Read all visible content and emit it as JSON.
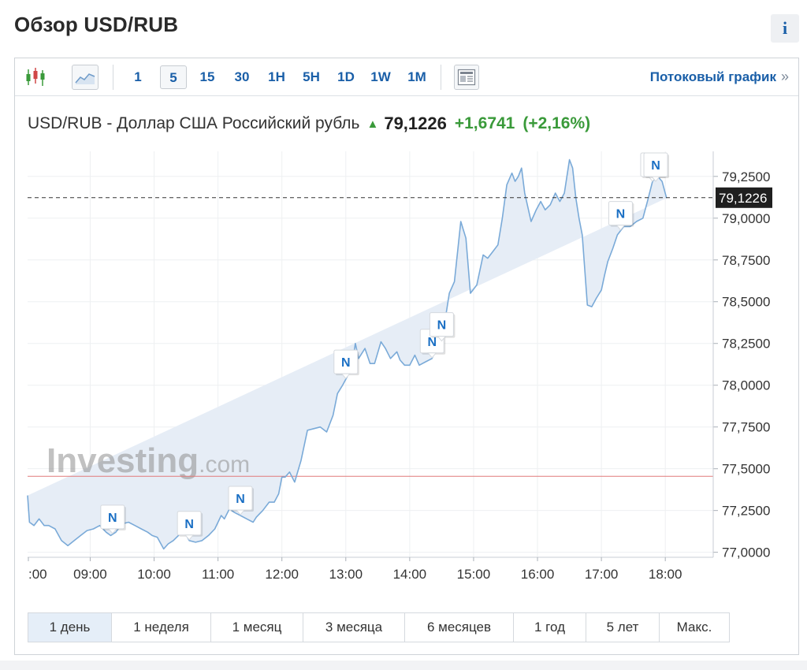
{
  "page": {
    "title": "Обзор USD/RUB",
    "info_label": "i"
  },
  "toolbar": {
    "intervals": [
      "1",
      "5",
      "15",
      "30",
      "1H",
      "5H",
      "1D",
      "1W",
      "1M"
    ],
    "active_interval": "5",
    "stream_link": "Потоковый график",
    "stream_arrow": "»",
    "icons": [
      "candlestick-icon",
      "area-chart-icon",
      "news-icon"
    ]
  },
  "quote": {
    "name": "USD/RUB - Доллар США Российский рубль",
    "price": "79,1226",
    "change": "+1,6741",
    "change_pct": "(+2,16%)",
    "direction_color": "#3a9a3a"
  },
  "watermark": {
    "brand": "Investing",
    "suffix": ".com"
  },
  "chart_data": {
    "type": "area",
    "x_unit": "hours",
    "xlim": [
      8.02,
      18.75
    ],
    "ylim": [
      76.97,
      79.4
    ],
    "y_ticks": [
      77.0,
      77.25,
      77.5,
      77.75,
      78.0,
      78.25,
      78.5,
      78.75,
      79.0,
      79.25
    ],
    "y_tick_labels": [
      "77,0000",
      "77,2500",
      "77,5000",
      "77,7500",
      "78,0000",
      "78,2500",
      "78,5000",
      "78,7500",
      "79,0000",
      "79,2500"
    ],
    "x_ticks": [
      8,
      9,
      10,
      11,
      12,
      13,
      14,
      15,
      16,
      17,
      18
    ],
    "x_tick_labels": [
      ":00",
      "09:00",
      "10:00",
      "11:00",
      "12:00",
      "13:00",
      "14:00",
      "15:00",
      "16:00",
      "17:00",
      "18:00"
    ],
    "current_price": 79.1226,
    "current_price_label": "79,1226",
    "previous_close": 77.455,
    "grid": true,
    "colors": {
      "line": "#7aaad8",
      "fill": "#e6edf6",
      "current": "#333333",
      "prev_close": "#e07a7a",
      "label_bg": "#1f1f1f"
    },
    "x": [
      8.02,
      8.05,
      8.12,
      8.2,
      8.28,
      8.35,
      8.45,
      8.55,
      8.65,
      8.75,
      8.85,
      8.95,
      9.05,
      9.15,
      9.25,
      9.32,
      9.4,
      9.5,
      9.6,
      9.7,
      9.8,
      9.9,
      9.97,
      10.05,
      10.15,
      10.22,
      10.3,
      10.38,
      10.45,
      10.55,
      10.65,
      10.75,
      10.85,
      10.95,
      11.05,
      11.1,
      11.18,
      11.25,
      11.35,
      11.45,
      11.55,
      11.6,
      11.7,
      11.8,
      11.88,
      11.95,
      12.0,
      12.05,
      12.12,
      12.2,
      12.3,
      12.4,
      12.5,
      12.6,
      12.7,
      12.8,
      12.87,
      12.95,
      13.02,
      13.1,
      13.15,
      13.2,
      13.3,
      13.38,
      13.45,
      13.55,
      13.62,
      13.7,
      13.8,
      13.85,
      13.92,
      14.0,
      14.08,
      14.15,
      14.25,
      14.35,
      14.45,
      14.5,
      14.55,
      14.62,
      14.7,
      14.8,
      14.88,
      14.95,
      15.05,
      15.15,
      15.22,
      15.3,
      15.38,
      15.45,
      15.52,
      15.6,
      15.65,
      15.7,
      15.75,
      15.8,
      15.9,
      15.98,
      16.05,
      16.12,
      16.2,
      16.28,
      16.35,
      16.42,
      16.5,
      16.55,
      16.6,
      16.65,
      16.7,
      16.78,
      16.85,
      16.92,
      17.0,
      17.05,
      17.1,
      17.18,
      17.25,
      17.35,
      17.45,
      17.55,
      17.65,
      17.72,
      17.8,
      17.88,
      17.95,
      18.02,
      18.1,
      18.18,
      18.25,
      18.35,
      18.45,
      18.55,
      18.65,
      18.72
    ],
    "y": [
      77.34,
      77.18,
      77.16,
      77.2,
      77.16,
      77.16,
      77.14,
      77.07,
      77.04,
      77.07,
      77.1,
      77.13,
      77.14,
      77.16,
      77.12,
      77.1,
      77.12,
      77.17,
      77.18,
      77.16,
      77.14,
      77.12,
      77.1,
      77.09,
      77.02,
      77.05,
      77.07,
      77.1,
      77.14,
      77.07,
      77.06,
      77.07,
      77.1,
      77.14,
      77.22,
      77.2,
      77.26,
      77.24,
      77.22,
      77.2,
      77.18,
      77.21,
      77.25,
      77.3,
      77.3,
      77.35,
      77.45,
      77.45,
      77.48,
      77.42,
      77.55,
      77.73,
      77.74,
      77.75,
      77.72,
      77.82,
      77.95,
      78.0,
      78.05,
      78.12,
      78.25,
      78.16,
      78.22,
      78.13,
      78.13,
      78.26,
      78.22,
      78.16,
      78.2,
      78.15,
      78.12,
      78.12,
      78.18,
      78.12,
      78.14,
      78.16,
      78.26,
      78.26,
      78.38,
      78.55,
      78.62,
      78.98,
      78.88,
      78.55,
      78.6,
      78.78,
      78.76,
      78.8,
      78.84,
      79.0,
      79.2,
      79.27,
      79.22,
      79.25,
      79.3,
      79.15,
      78.98,
      79.05,
      79.1,
      79.05,
      79.08,
      79.15,
      79.1,
      79.15,
      79.35,
      79.3,
      79.12,
      79.0,
      78.9,
      78.48,
      78.47,
      78.52,
      78.57,
      78.66,
      78.74,
      78.82,
      78.9,
      78.95,
      78.95,
      78.98,
      79.0,
      79.1,
      79.22,
      79.25,
      79.22,
      79.12
    ],
    "news_markers": [
      {
        "x": 9.35,
        "label": "N"
      },
      {
        "x": 10.55,
        "label": "N"
      },
      {
        "x": 11.35,
        "label": "N"
      },
      {
        "x": 13.0,
        "label": "N"
      },
      {
        "x": 14.35,
        "label": "N"
      },
      {
        "x": 14.5,
        "label": "N"
      },
      {
        "x": 17.3,
        "label": "N"
      },
      {
        "x": 17.8,
        "label": "N"
      },
      {
        "x": 17.85,
        "label": "N"
      }
    ]
  },
  "ranges": {
    "items": [
      "1 день",
      "1 неделя",
      "1 месяц",
      "3 месяца",
      "6 месяцев",
      "1 год",
      "5 лет",
      "Макс."
    ],
    "active": "1 день"
  }
}
